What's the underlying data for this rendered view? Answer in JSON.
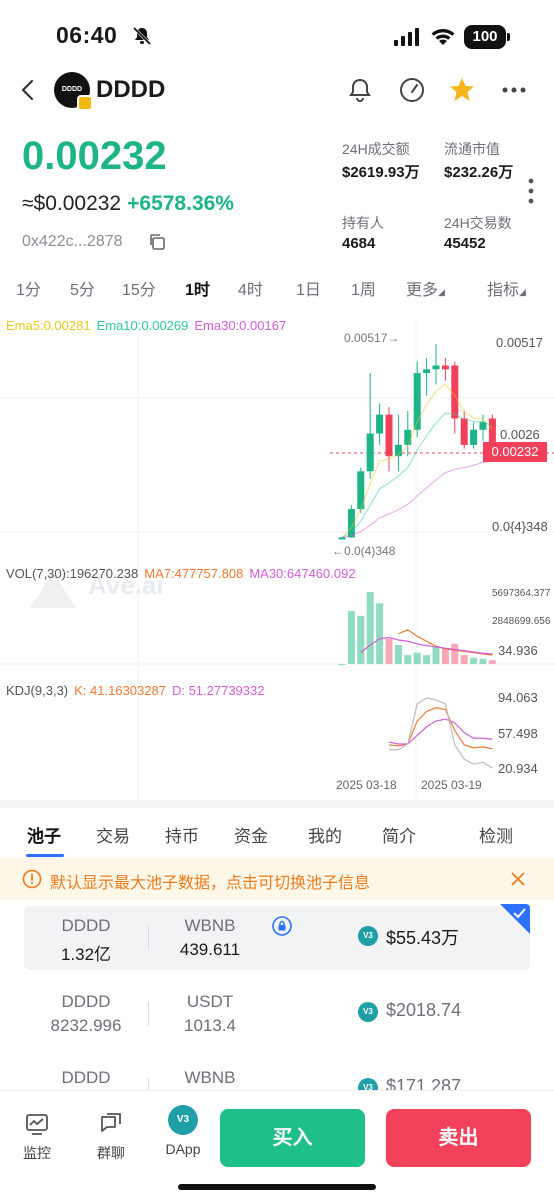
{
  "status_bar": {
    "time": "06:40",
    "battery": "100"
  },
  "header": {
    "token_name": "DDDD",
    "logo_text": "DDDD"
  },
  "price": {
    "main": "0.00232",
    "usd": "≈$0.00232",
    "change": "+6578.36%",
    "contract": "0x422c...2878"
  },
  "stats": [
    {
      "label": "24H成交额",
      "value": "$2619.93万"
    },
    {
      "label": "流通市值",
      "value": "$232.26万"
    },
    {
      "label": "持有人",
      "value": "4684"
    },
    {
      "label": "24H交易数",
      "value": "45452"
    }
  ],
  "timeframes": [
    "1分",
    "5分",
    "15分",
    "1时",
    "4时",
    "1日",
    "1周",
    "更多",
    "指标"
  ],
  "active_timeframe": "1时",
  "indicators": {
    "ema5": "Ema5:0.00281",
    "ema10": "Ema10:0.00269",
    "ema30": "Ema30:0.00167",
    "vol": "VOL(7,30):196270.238",
    "ma7": "MA7:477757.808",
    "ma30": "MA30:647460.092",
    "kdj": "KDJ(9,3,3)",
    "kdj_k": "K: 41.16303287",
    "kdj_d": "D: 51.27739332"
  },
  "price_axis": {
    "high": "0.00517",
    "mid": "0.0026",
    "low": "0.0{4}348",
    "current": "0.00232",
    "high_marker": "0.00517→",
    "low_marker": "←0.0(4)348"
  },
  "volume_axis": {
    "high": "5697364.377",
    "mid": "2848699.656",
    "low": "34.936"
  },
  "kdj_axis": {
    "high": "94.063",
    "mid": "57.498",
    "low": "20.934"
  },
  "dates": [
    "2025 03-18",
    "2025 03-19"
  ],
  "watermark": "Ave.ai",
  "tabs": [
    "池子",
    "交易",
    "持币",
    "资金",
    "我的",
    "简介",
    "检测"
  ],
  "active_tab": "池子",
  "notice": "默认显示最大池子数据，点击可切换池子信息",
  "pools": [
    {
      "token_a": "DDDD",
      "amount_a": "1.32亿",
      "token_b": "WBNB",
      "amount_b": "439.611",
      "badge": "V3",
      "liquidity": "$55.43万",
      "selected": true
    },
    {
      "token_a": "DDDD",
      "amount_a": "8232.996",
      "token_b": "USDT",
      "amount_b": "1013.4",
      "badge": "V3",
      "liquidity": "$2018.74",
      "selected": false
    },
    {
      "token_a": "DDDD",
      "amount_a": "",
      "token_b": "WBNB",
      "amount_b": "",
      "badge": "V3",
      "liquidity": "$171.287",
      "selected": false
    }
  ],
  "bottom_nav": {
    "monitor": "监控",
    "group_chat": "群聊",
    "dapp": "DApp",
    "dapp_badge": "V3",
    "buy": "买入",
    "sell": "卖出"
  },
  "colors": {
    "up": "#1db488",
    "down": "#f2405a",
    "accent": "#2d71ff",
    "warning": "#ef7a1a"
  },
  "chart_data": [
    {
      "type": "candlestick",
      "title": "",
      "xlabel": "",
      "ylabel": "",
      "x_ticks": [
        "2025 03-18",
        "2025 03-19"
      ],
      "y_ticks": [
        "0.00517",
        "0.0026",
        "0.0{4}348"
      ],
      "last_value": 0.00232,
      "ema": {
        "ema5": 0.00281,
        "ema10": 0.00269,
        "ema30": 0.00167
      },
      "candles": [
        {
          "o": 4e-05,
          "h": 6e-05,
          "l": 3.48e-05,
          "c": 5e-05,
          "dir": "up"
        },
        {
          "o": 5e-05,
          "h": 0.0009,
          "l": 4e-05,
          "c": 0.0008,
          "dir": "up"
        },
        {
          "o": 0.0008,
          "h": 0.0019,
          "l": 0.0007,
          "c": 0.0018,
          "dir": "up"
        },
        {
          "o": 0.0018,
          "h": 0.0044,
          "l": 0.0016,
          "c": 0.0028,
          "dir": "up"
        },
        {
          "o": 0.0028,
          "h": 0.0036,
          "l": 0.0025,
          "c": 0.0033,
          "dir": "up"
        },
        {
          "o": 0.0033,
          "h": 0.0035,
          "l": 0.0018,
          "c": 0.0022,
          "dir": "down"
        },
        {
          "o": 0.0022,
          "h": 0.0033,
          "l": 0.0018,
          "c": 0.0025,
          "dir": "up"
        },
        {
          "o": 0.0025,
          "h": 0.0034,
          "l": 0.0022,
          "c": 0.0029,
          "dir": "up"
        },
        {
          "o": 0.0029,
          "h": 0.0047,
          "l": 0.0027,
          "c": 0.0044,
          "dir": "up"
        },
        {
          "o": 0.0044,
          "h": 0.0048,
          "l": 0.0038,
          "c": 0.0045,
          "dir": "up"
        },
        {
          "o": 0.0045,
          "h": 0.00517,
          "l": 0.0041,
          "c": 0.0046,
          "dir": "up"
        },
        {
          "o": 0.0046,
          "h": 0.0048,
          "l": 0.0042,
          "c": 0.0045,
          "dir": "down"
        },
        {
          "o": 0.0046,
          "h": 0.0047,
          "l": 0.0028,
          "c": 0.0032,
          "dir": "down"
        },
        {
          "o": 0.0032,
          "h": 0.0034,
          "l": 0.0024,
          "c": 0.0025,
          "dir": "down"
        },
        {
          "o": 0.0025,
          "h": 0.0031,
          "l": 0.0024,
          "c": 0.0029,
          "dir": "up"
        },
        {
          "o": 0.0029,
          "h": 0.0033,
          "l": 0.0026,
          "c": 0.0031,
          "dir": "up"
        },
        {
          "o": 0.0032,
          "h": 0.0033,
          "l": 0.0023,
          "c": 0.00242,
          "dir": "down"
        }
      ]
    },
    {
      "type": "bar",
      "title": "VOL(7,30)",
      "y_ticks": [
        "5697364.377",
        "2848699.656",
        "34.936"
      ],
      "values": [
        0,
        4200000,
        3800000,
        5697364,
        4800000,
        2000000,
        1500000,
        700000,
        900000,
        700000,
        1400000,
        1200000,
        1600000,
        700000,
        500000,
        400000,
        300000
      ],
      "dir": [
        "up",
        "up",
        "up",
        "up",
        "up",
        "down",
        "up",
        "up",
        "up",
        "up",
        "up",
        "down",
        "down",
        "down",
        "up",
        "up",
        "down"
      ],
      "series": [
        {
          "name": "MA7",
          "values": [
            null,
            null,
            null,
            null,
            null,
            null,
            2400000,
            2700000,
            2200000,
            1800000,
            1400000,
            1200000,
            1100000,
            1000000,
            900000,
            800000,
            700000
          ]
        },
        {
          "name": "MA30",
          "values": [
            null,
            null,
            900000,
            1500000,
            2000000,
            2100000,
            1900000,
            1800000,
            1600000,
            1450000,
            1350000,
            1250000,
            1150000,
            1050000,
            950000,
            850000,
            800000
          ]
        }
      ]
    },
    {
      "type": "line",
      "title": "KDJ(9,3,3)",
      "y_ticks": [
        "94.063",
        "57.498",
        "20.934"
      ],
      "series": [
        {
          "name": "K",
          "values": [
            null,
            null,
            null,
            null,
            null,
            45,
            44,
            46,
            70,
            80,
            84,
            82,
            60,
            45,
            42,
            43,
            41
          ]
        },
        {
          "name": "D",
          "values": [
            null,
            null,
            null,
            null,
            null,
            48,
            46,
            46,
            55,
            64,
            70,
            72,
            68,
            58,
            52,
            52,
            51
          ]
        },
        {
          "name": "J",
          "values": [
            null,
            null,
            null,
            null,
            null,
            40,
            40,
            46,
            88,
            94,
            92,
            88,
            45,
            30,
            25,
            27,
            21
          ]
        }
      ]
    }
  ]
}
